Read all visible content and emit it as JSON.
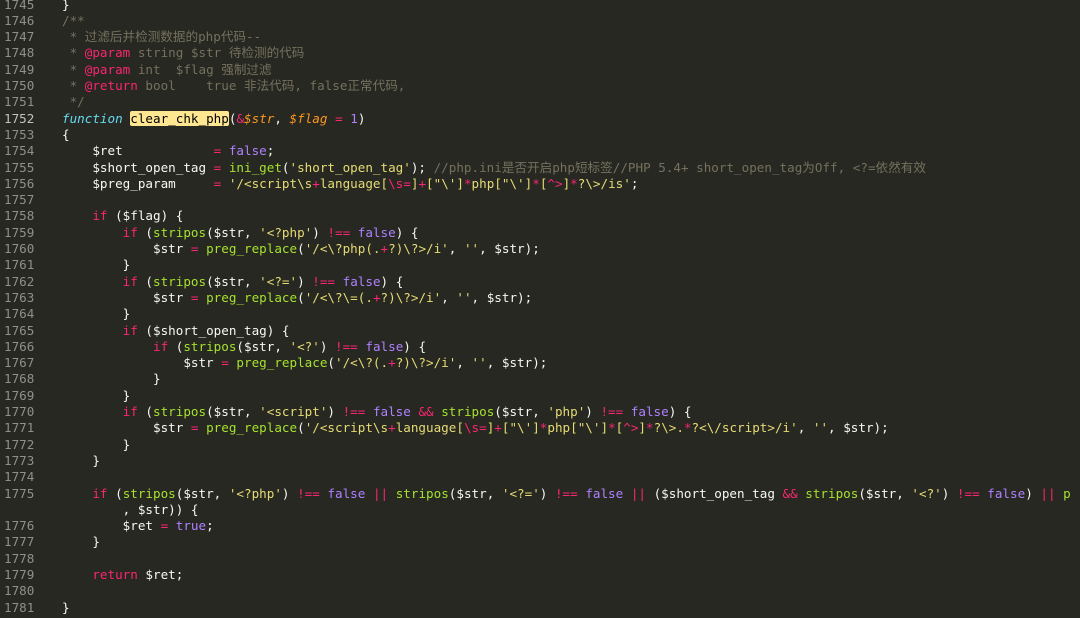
{
  "editor": {
    "line_numbers": [
      "1745",
      "1746",
      "1747",
      "1748",
      "1749",
      "1750",
      "1751",
      "1752",
      "1753",
      "1754",
      "1755",
      "1756",
      "1757",
      "1758",
      "1759",
      "1760",
      "1761",
      "1762",
      "1763",
      "1764",
      "1765",
      "1766",
      "1767",
      "1768",
      "1769",
      "1770",
      "1771",
      "1772",
      "1773",
      "1774",
      "1775",
      "",
      "1776",
      "1777",
      "1778",
      "1779",
      "1780",
      "1781"
    ],
    "active_line": "1752",
    "theme": {
      "background": "#272822",
      "comment": "#75715e",
      "keyword": "#f92672",
      "function": "#a6e22e",
      "string": "#e6db74",
      "constant": "#ae81ff",
      "parameter": "#fd971f",
      "storage": "#66d9ef",
      "highlight": "#ffe792"
    },
    "lines": [
      [
        [
          "pln",
          "}"
        ]
      ],
      [
        [
          "cmt",
          "/**"
        ]
      ],
      [
        [
          "cmt",
          " * 过滤后并检测数据的php代码--"
        ]
      ],
      [
        [
          "cmt",
          " * "
        ],
        [
          "kw",
          "@param"
        ],
        [
          "cmt",
          " string $str 待检测的代码"
        ]
      ],
      [
        [
          "cmt",
          " * "
        ],
        [
          "kw",
          "@param"
        ],
        [
          "cmt",
          " int  $flag 强制过滤"
        ]
      ],
      [
        [
          "cmt",
          " * "
        ],
        [
          "kw",
          "@return"
        ],
        [
          "cmt",
          " bool    true 非法代码, false正常代码,"
        ]
      ],
      [
        [
          "cmt",
          " */"
        ]
      ],
      [
        [
          "type",
          "function"
        ],
        [
          "pln",
          " "
        ],
        [
          "hl",
          "clear_chk_php"
        ],
        [
          "pln",
          "("
        ],
        [
          "kw",
          "&"
        ],
        [
          "var-i",
          "$str"
        ],
        [
          "pln",
          ", "
        ],
        [
          "var-i",
          "$flag"
        ],
        [
          "pln",
          " "
        ],
        [
          "kw",
          "="
        ],
        [
          "pln",
          " "
        ],
        [
          "num",
          "1"
        ],
        [
          "pln",
          ")"
        ]
      ],
      [
        [
          "pln",
          "{"
        ]
      ],
      [
        [
          "pln",
          "    $ret            "
        ],
        [
          "kw",
          "="
        ],
        [
          "pln",
          " "
        ],
        [
          "num",
          "false"
        ],
        [
          "pln",
          ";"
        ]
      ],
      [
        [
          "pln",
          "    $short_open_tag "
        ],
        [
          "kw",
          "="
        ],
        [
          "pln",
          " "
        ],
        [
          "fn",
          "ini_get"
        ],
        [
          "pln",
          "("
        ],
        [
          "str",
          "'short_open_tag'"
        ],
        [
          "pln",
          "); "
        ],
        [
          "cmt",
          "//php.ini是否开启php短标签//PHP 5.4+ short_open_tag为Off, <?=依然有效"
        ]
      ],
      [
        [
          "pln",
          "    $preg_param     "
        ],
        [
          "kw",
          "="
        ],
        [
          "pln",
          " "
        ],
        [
          "str",
          "'/<script\\s"
        ],
        [
          "kw",
          "+"
        ],
        [
          "str",
          "language["
        ],
        [
          "kw",
          "\\s="
        ],
        [
          "str",
          "]"
        ],
        [
          "kw",
          "+"
        ],
        [
          "str",
          "[\"\\']"
        ],
        [
          "kw",
          "*"
        ],
        [
          "str",
          "php[\"\\']"
        ],
        [
          "kw",
          "*"
        ],
        [
          "str",
          "["
        ],
        [
          "kw",
          "^>"
        ],
        [
          "str",
          "]"
        ],
        [
          "kw",
          "*"
        ],
        [
          "str",
          "?\\>/is'"
        ],
        [
          "pln",
          ";"
        ]
      ],
      [
        [
          "pln",
          ""
        ]
      ],
      [
        [
          "pln",
          "    "
        ],
        [
          "kw",
          "if"
        ],
        [
          "pln",
          " ($flag) {"
        ]
      ],
      [
        [
          "pln",
          "        "
        ],
        [
          "kw",
          "if"
        ],
        [
          "pln",
          " ("
        ],
        [
          "fn",
          "stripos"
        ],
        [
          "pln",
          "($str, "
        ],
        [
          "str",
          "'<?php'"
        ],
        [
          "pln",
          ") "
        ],
        [
          "kw",
          "!=="
        ],
        [
          "pln",
          " "
        ],
        [
          "num",
          "false"
        ],
        [
          "pln",
          ") {"
        ]
      ],
      [
        [
          "pln",
          "            $str "
        ],
        [
          "kw",
          "="
        ],
        [
          "pln",
          " "
        ],
        [
          "fn",
          "preg_replace"
        ],
        [
          "pln",
          "("
        ],
        [
          "str",
          "'/<\\?php(."
        ],
        [
          "kw",
          "+"
        ],
        [
          "str",
          "?)\\?>/i'"
        ],
        [
          "pln",
          ", "
        ],
        [
          "str",
          "''"
        ],
        [
          "pln",
          ", $str);"
        ]
      ],
      [
        [
          "pln",
          "        }"
        ]
      ],
      [
        [
          "pln",
          "        "
        ],
        [
          "kw",
          "if"
        ],
        [
          "pln",
          " ("
        ],
        [
          "fn",
          "stripos"
        ],
        [
          "pln",
          "($str, "
        ],
        [
          "str",
          "'<?='"
        ],
        [
          "pln",
          ") "
        ],
        [
          "kw",
          "!=="
        ],
        [
          "pln",
          " "
        ],
        [
          "num",
          "false"
        ],
        [
          "pln",
          ") {"
        ]
      ],
      [
        [
          "pln",
          "            $str "
        ],
        [
          "kw",
          "="
        ],
        [
          "pln",
          " "
        ],
        [
          "fn",
          "preg_replace"
        ],
        [
          "pln",
          "("
        ],
        [
          "str",
          "'/<\\?\\=(."
        ],
        [
          "kw",
          "+"
        ],
        [
          "str",
          "?)\\?>/i'"
        ],
        [
          "pln",
          ", "
        ],
        [
          "str",
          "''"
        ],
        [
          "pln",
          ", $str);"
        ]
      ],
      [
        [
          "pln",
          "        }"
        ]
      ],
      [
        [
          "pln",
          "        "
        ],
        [
          "kw",
          "if"
        ],
        [
          "pln",
          " ($short_open_tag) {"
        ]
      ],
      [
        [
          "pln",
          "            "
        ],
        [
          "kw",
          "if"
        ],
        [
          "pln",
          " ("
        ],
        [
          "fn",
          "stripos"
        ],
        [
          "pln",
          "($str, "
        ],
        [
          "str",
          "'<?'"
        ],
        [
          "pln",
          ") "
        ],
        [
          "kw",
          "!=="
        ],
        [
          "pln",
          " "
        ],
        [
          "num",
          "false"
        ],
        [
          "pln",
          ") {"
        ]
      ],
      [
        [
          "pln",
          "                $str "
        ],
        [
          "kw",
          "="
        ],
        [
          "pln",
          " "
        ],
        [
          "fn",
          "preg_replace"
        ],
        [
          "pln",
          "("
        ],
        [
          "str",
          "'/<\\?(."
        ],
        [
          "kw",
          "+"
        ],
        [
          "str",
          "?)\\?>/i'"
        ],
        [
          "pln",
          ", "
        ],
        [
          "str",
          "''"
        ],
        [
          "pln",
          ", $str);"
        ]
      ],
      [
        [
          "pln",
          "            }"
        ]
      ],
      [
        [
          "pln",
          "        }"
        ]
      ],
      [
        [
          "pln",
          "        "
        ],
        [
          "kw",
          "if"
        ],
        [
          "pln",
          " ("
        ],
        [
          "fn",
          "stripos"
        ],
        [
          "pln",
          "($str, "
        ],
        [
          "str",
          "'<script'"
        ],
        [
          "pln",
          ") "
        ],
        [
          "kw",
          "!=="
        ],
        [
          "pln",
          " "
        ],
        [
          "num",
          "false"
        ],
        [
          "pln",
          " "
        ],
        [
          "kw",
          "&&"
        ],
        [
          "pln",
          " "
        ],
        [
          "fn",
          "stripos"
        ],
        [
          "pln",
          "($str, "
        ],
        [
          "str",
          "'php'"
        ],
        [
          "pln",
          ") "
        ],
        [
          "kw",
          "!=="
        ],
        [
          "pln",
          " "
        ],
        [
          "num",
          "false"
        ],
        [
          "pln",
          ") {"
        ]
      ],
      [
        [
          "pln",
          "            $str "
        ],
        [
          "kw",
          "="
        ],
        [
          "pln",
          " "
        ],
        [
          "fn",
          "preg_replace"
        ],
        [
          "pln",
          "("
        ],
        [
          "str",
          "'/<script\\s"
        ],
        [
          "kw",
          "+"
        ],
        [
          "str",
          "language["
        ],
        [
          "kw",
          "\\s="
        ],
        [
          "str",
          "]"
        ],
        [
          "kw",
          "+"
        ],
        [
          "str",
          "[\"\\']"
        ],
        [
          "kw",
          "*"
        ],
        [
          "str",
          "php[\"\\']"
        ],
        [
          "kw",
          "*"
        ],
        [
          "str",
          "["
        ],
        [
          "kw",
          "^>"
        ],
        [
          "str",
          "]"
        ],
        [
          "kw",
          "*"
        ],
        [
          "str",
          "?\\>."
        ],
        [
          "kw",
          "*"
        ],
        [
          "str",
          "?<\\/script>/i'"
        ],
        [
          "pln",
          ", "
        ],
        [
          "str",
          "''"
        ],
        [
          "pln",
          ", $str);"
        ]
      ],
      [
        [
          "pln",
          "        }"
        ]
      ],
      [
        [
          "pln",
          "    }"
        ]
      ],
      [
        [
          "pln",
          ""
        ]
      ],
      [
        [
          "pln",
          "    "
        ],
        [
          "kw",
          "if"
        ],
        [
          "pln",
          " ("
        ],
        [
          "fn",
          "stripos"
        ],
        [
          "pln",
          "($str, "
        ],
        [
          "str",
          "'<?php'"
        ],
        [
          "pln",
          ") "
        ],
        [
          "kw",
          "!=="
        ],
        [
          "pln",
          " "
        ],
        [
          "num",
          "false"
        ],
        [
          "pln",
          " "
        ],
        [
          "kw",
          "||"
        ],
        [
          "pln",
          " "
        ],
        [
          "fn",
          "stripos"
        ],
        [
          "pln",
          "($str, "
        ],
        [
          "str",
          "'<?='"
        ],
        [
          "pln",
          ") "
        ],
        [
          "kw",
          "!=="
        ],
        [
          "pln",
          " "
        ],
        [
          "num",
          "false"
        ],
        [
          "pln",
          " "
        ],
        [
          "kw",
          "||"
        ],
        [
          "pln",
          " ($short_open_tag "
        ],
        [
          "kw",
          "&&"
        ],
        [
          "pln",
          " "
        ],
        [
          "fn",
          "stripos"
        ],
        [
          "pln",
          "($str, "
        ],
        [
          "str",
          "'<?'"
        ],
        [
          "pln",
          ") "
        ],
        [
          "kw",
          "!=="
        ],
        [
          "pln",
          " "
        ],
        [
          "num",
          "false"
        ],
        [
          "pln",
          ") "
        ],
        [
          "kw",
          "||"
        ],
        [
          "pln",
          " "
        ],
        [
          "fn",
          "p"
        ]
      ],
      [
        [
          "pln",
          "        , $str)) {"
        ]
      ],
      [
        [
          "pln",
          "        $ret "
        ],
        [
          "kw",
          "="
        ],
        [
          "pln",
          " "
        ],
        [
          "num",
          "true"
        ],
        [
          "pln",
          ";"
        ]
      ],
      [
        [
          "pln",
          "    }"
        ]
      ],
      [
        [
          "pln",
          ""
        ]
      ],
      [
        [
          "pln",
          "    "
        ],
        [
          "kw",
          "return"
        ],
        [
          "pln",
          " $ret;"
        ]
      ],
      [
        [
          "pln",
          ""
        ]
      ],
      [
        [
          "pln",
          "}"
        ]
      ]
    ]
  }
}
